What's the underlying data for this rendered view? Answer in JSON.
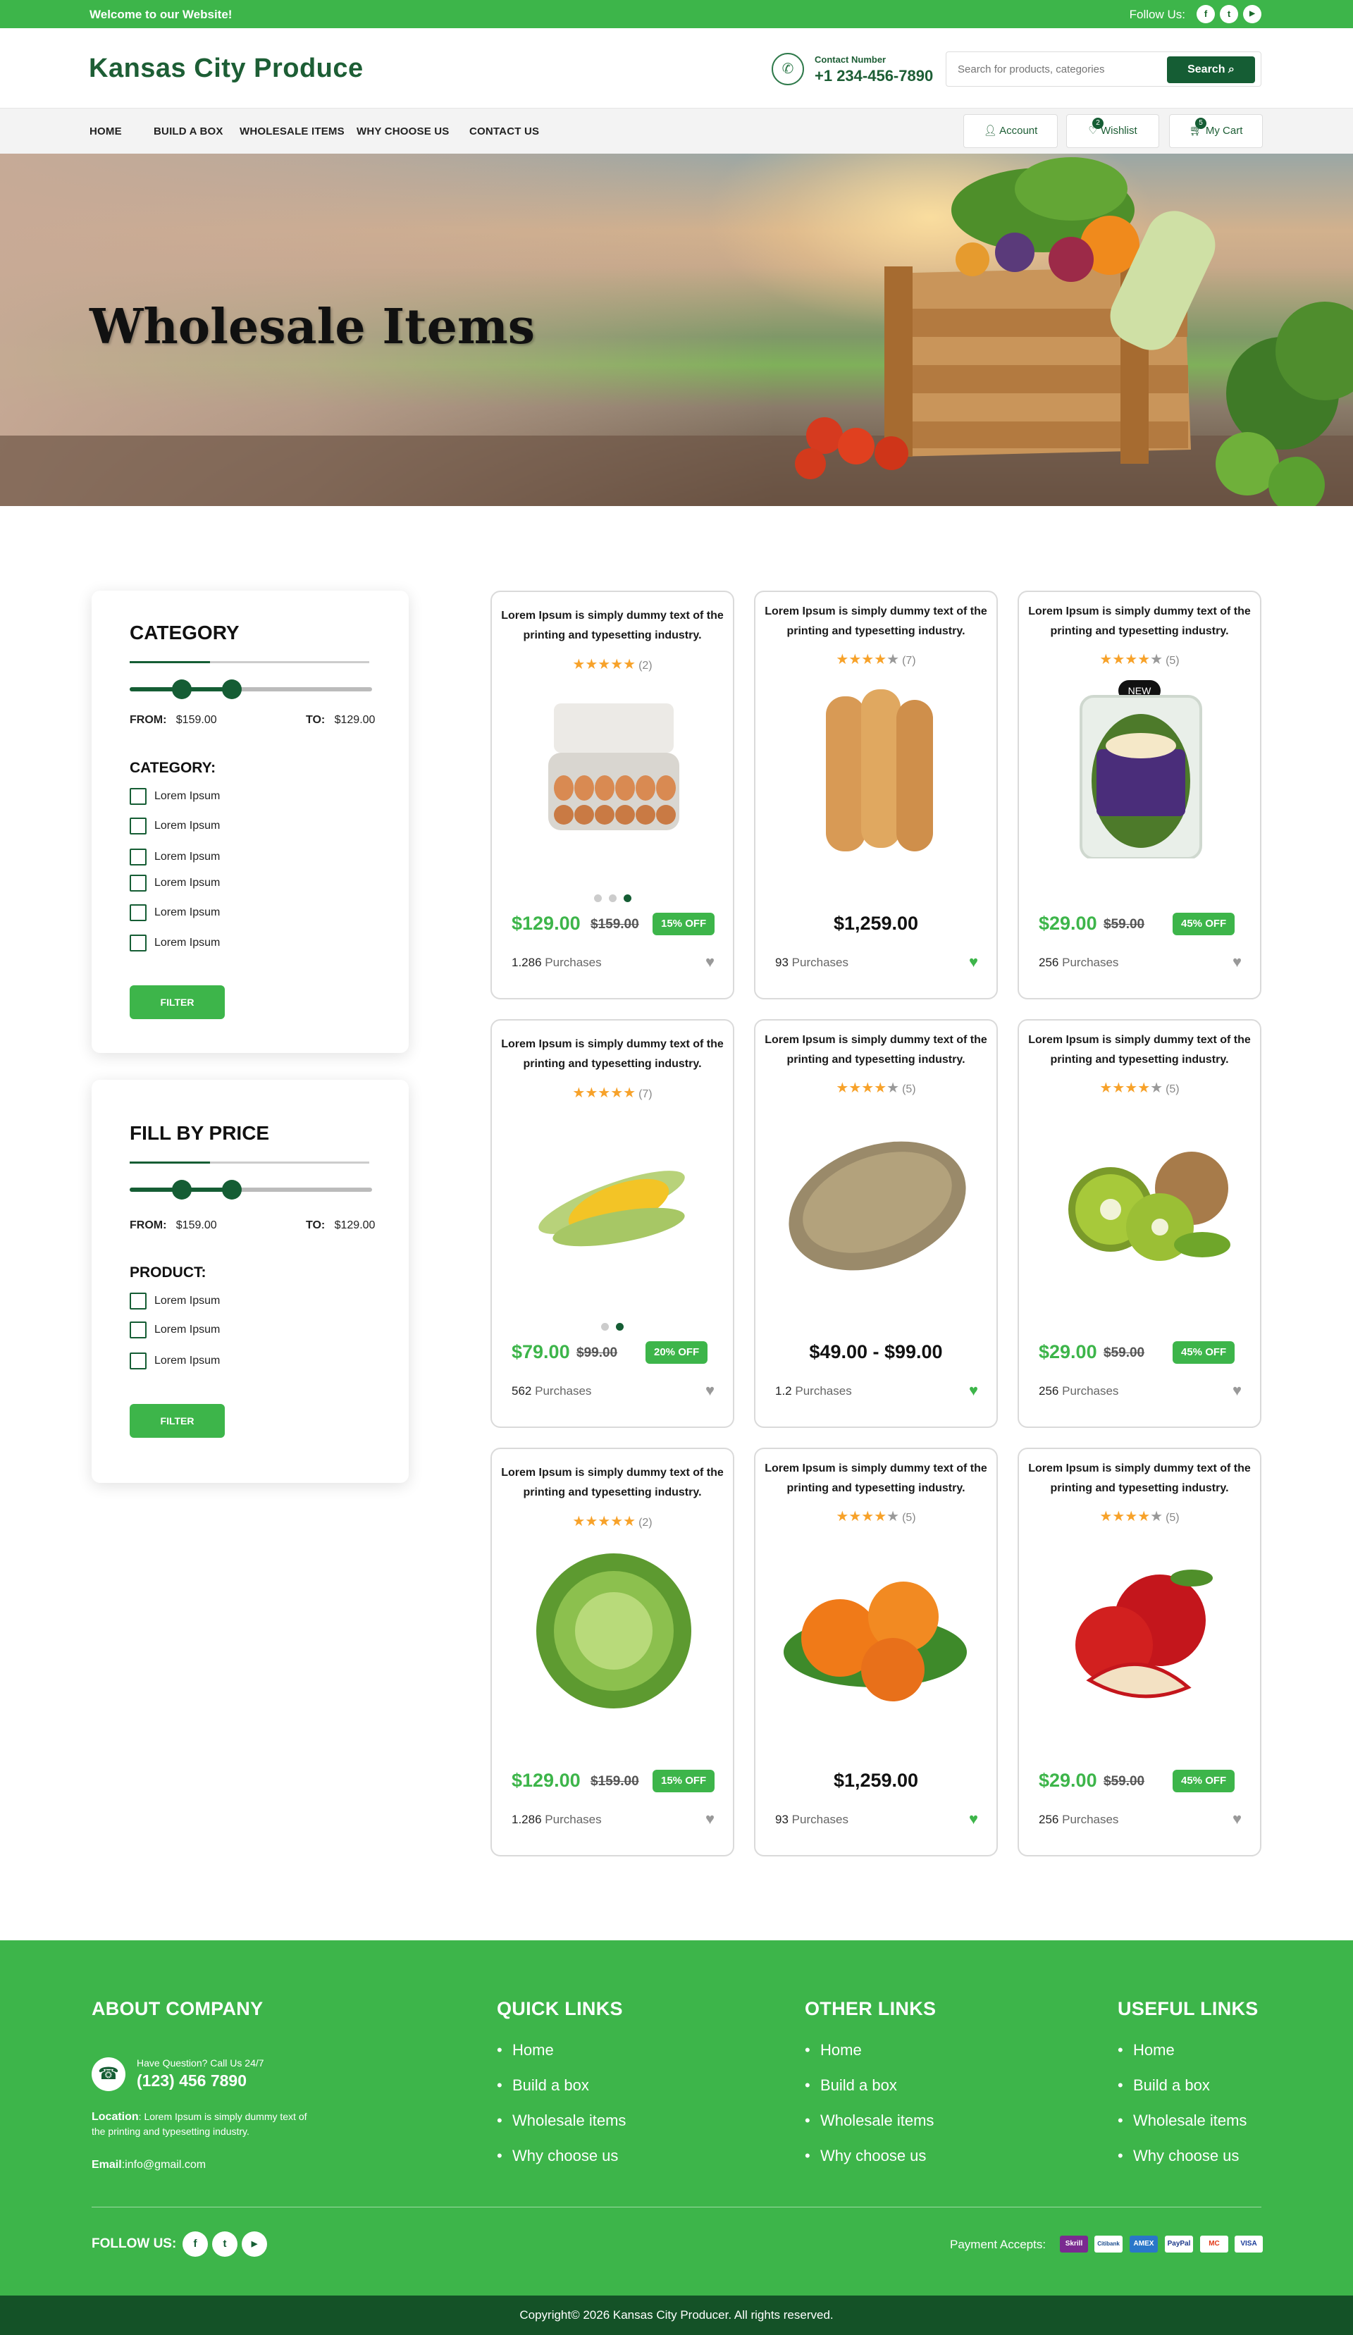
{
  "topbar": {
    "welcome": "Welcome to our Website!",
    "follow_label": "Follow Us:",
    "social": [
      "f",
      "t",
      "▶"
    ]
  },
  "header": {
    "logo": "Kansas City Produce",
    "contact_label": "Contact Number",
    "contact_number": "+1 234-456-7890",
    "search_placeholder": "Search for products, categories",
    "search_button": "Search"
  },
  "nav": {
    "items": [
      "HOME",
      "BUILD A BOX",
      "WHOLESALE ITEMS",
      "WHY CHOOSE US",
      "CONTACT US"
    ],
    "account": "Account",
    "wishlist": "Wishlist",
    "wishlist_count": "2",
    "cart": "My Cart",
    "cart_count": "5"
  },
  "hero": {
    "title": "Wholesale Items"
  },
  "filter_category": {
    "title": "CATEGORY",
    "from_label": "FROM:",
    "from_value": "$159.00",
    "to_label": "TO:",
    "to_value": "$129.00",
    "subheading": "CATEGORY:",
    "options": [
      "Lorem Ipsum",
      "Lorem Ipsum",
      "Lorem Ipsum",
      "Lorem Ipsum",
      "Lorem Ipsum",
      "Lorem Ipsum"
    ],
    "button": "FILTER"
  },
  "filter_price": {
    "title": "FILL BY PRICE",
    "from_label": "FROM:",
    "from_value": "$159.00",
    "to_label": "TO:",
    "to_value": "$129.00",
    "subheading": "PRODUCT:",
    "options": [
      "Lorem Ipsum",
      "Lorem Ipsum",
      "Lorem Ipsum"
    ],
    "button": "FILTER"
  },
  "products": [
    {
      "title": "Lorem Ipsum is simply dummy text of the printing and typesetting industry.",
      "stars": 5,
      "reviews": "(2)",
      "image": "egg-carton-image",
      "price": "$129.00",
      "old_price": "$159.00",
      "discount": "15% OFF",
      "purchases_num": "1.286",
      "purchases_label": "Purchases",
      "liked": false,
      "dots": 3,
      "active_dot": 3
    },
    {
      "title": "Lorem Ipsum is simply dummy text of the printing and typesetting industry.",
      "stars": 4,
      "reviews": "(7)",
      "image": "bread-twists-image",
      "price": "$1,259.00",
      "purchases_num": "93",
      "purchases_label": "Purchases",
      "liked": true
    },
    {
      "title": "Lorem Ipsum is simply dummy text of the printing and typesetting industry.",
      "stars": 4,
      "reviews": "(5)",
      "image": "spring-mix-image",
      "badge": "NEW",
      "price": "$29.00",
      "old_price": "$59.00",
      "discount": "45% OFF",
      "purchases_num": "256",
      "purchases_label": "Purchases",
      "liked": false
    },
    {
      "title": "Lorem Ipsum is simply dummy text of the printing and typesetting industry.",
      "stars": 5,
      "reviews": "(7)",
      "image": "corn-image",
      "price": "$79.00",
      "old_price": "$99.00",
      "discount": "20% OFF",
      "purchases_num": "562",
      "purchases_label": "Purchases",
      "liked": false,
      "dots": 2,
      "active_dot": 2
    },
    {
      "title": "Lorem Ipsum is simply dummy text of the printing and typesetting industry.",
      "stars": 4,
      "reviews": "(5)",
      "image": "bread-loaf-image",
      "price": "$49.00 - $99.00",
      "purchases_num": "1.2",
      "purchases_label": "Purchases",
      "liked": true
    },
    {
      "title": "Lorem Ipsum is simply dummy text of the printing and typesetting industry.",
      "stars": 4,
      "reviews": "(5)",
      "image": "kiwi-image",
      "price": "$29.00",
      "old_price": "$59.00",
      "discount": "45% OFF",
      "purchases_num": "256",
      "purchases_label": "Purchases",
      "liked": false
    },
    {
      "title": "Lorem Ipsum is simply dummy text of the printing and typesetting industry.",
      "stars": 5,
      "reviews": "(2)",
      "image": "cabbage-image",
      "price": "$129.00",
      "old_price": "$159.00",
      "discount": "15% OFF",
      "purchases_num": "1.286",
      "purchases_label": "Purchases",
      "liked": false
    },
    {
      "title": "Lorem Ipsum is simply dummy text of the printing and typesetting industry.",
      "stars": 4,
      "reviews": "(5)",
      "image": "persimmon-image",
      "price": "$1,259.00",
      "purchases_num": "93",
      "purchases_label": "Purchases",
      "liked": true
    },
    {
      "title": "Lorem Ipsum is simply dummy text of the printing and typesetting industry.",
      "stars": 4,
      "reviews": "(5)",
      "image": "apple-image",
      "price": "$29.00",
      "old_price": "$59.00",
      "discount": "45% OFF",
      "purchases_num": "256",
      "purchases_label": "Purchases",
      "liked": false
    }
  ],
  "footer": {
    "about": {
      "title": "ABOUT COMPANY",
      "question": "Have Question? Call Us 24/7",
      "phone": "(123) 456 7890",
      "location_label": "Location",
      "location_text": ": Lorem Ipsum is simply dummy text of the printing and typesetting industry.",
      "email_label": "Email",
      "email": ":info@gmail.com"
    },
    "quick": {
      "title": "QUICK LINKS",
      "links": [
        "Home",
        "Build a box",
        "Wholesale items",
        "Why choose us"
      ]
    },
    "other": {
      "title": "OTHER LINKS",
      "links": [
        "Home",
        "Build a box",
        "Wholesale items",
        "Why choose us"
      ]
    },
    "useful": {
      "title": "USEFUL LINKS",
      "links": [
        "Home",
        "Build a box",
        "Wholesale items",
        "Why choose us"
      ]
    },
    "follow_label": "FOLLOW US:",
    "social": [
      "f",
      "t",
      "▶"
    ],
    "payment_label": "Payment Accepts:",
    "payments": [
      "Skrill",
      "Citibank",
      "AMEX",
      "PayPal",
      "MC",
      "VISA"
    ]
  },
  "copyright": "Copyright© 2026 Kansas City Producer. All rights reserved.",
  "colors": {
    "brand_green": "#3db54a",
    "dark_green": "#155d34",
    "star": "#f7a22a"
  }
}
